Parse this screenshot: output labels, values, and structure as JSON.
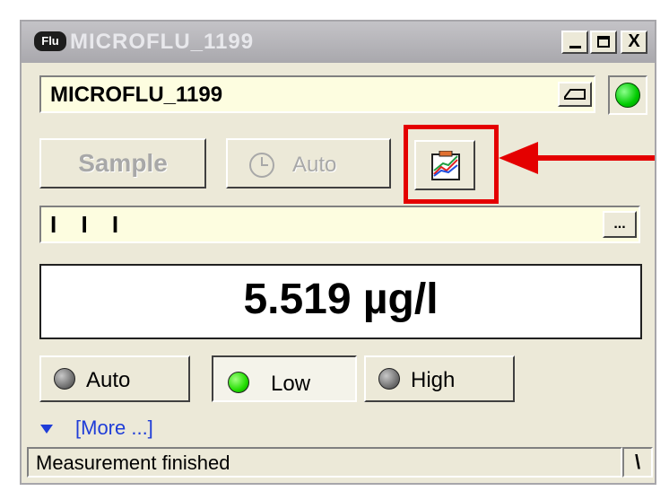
{
  "window": {
    "app_icon_label": "Flu",
    "title": "MICROFLU_1199",
    "minimize_icon": "minimize-icon",
    "maximize_icon": "maximize-icon",
    "close_label": "X"
  },
  "device": {
    "name": "MICROFLU_1199",
    "connect_icon": "connect-icon",
    "status_color": "#00cc00"
  },
  "toolbar": {
    "sample_label": "Sample",
    "auto_label": "Auto",
    "auto_icon": "clock-icon",
    "chart_icon": "chart-icon"
  },
  "sequence": {
    "value": "I I I",
    "more_label": "..."
  },
  "reading": {
    "value": "5.519 µg/l"
  },
  "range": {
    "auto_label": "Auto",
    "low_label": "Low",
    "high_label": "High",
    "selected": "Low"
  },
  "more": {
    "label": "[More ...]"
  },
  "status": {
    "text": "Measurement finished",
    "corner": "\\"
  },
  "colors": {
    "highlight": "#e40000",
    "link": "#1f3dd8",
    "field_bg": "#fdfde0"
  }
}
